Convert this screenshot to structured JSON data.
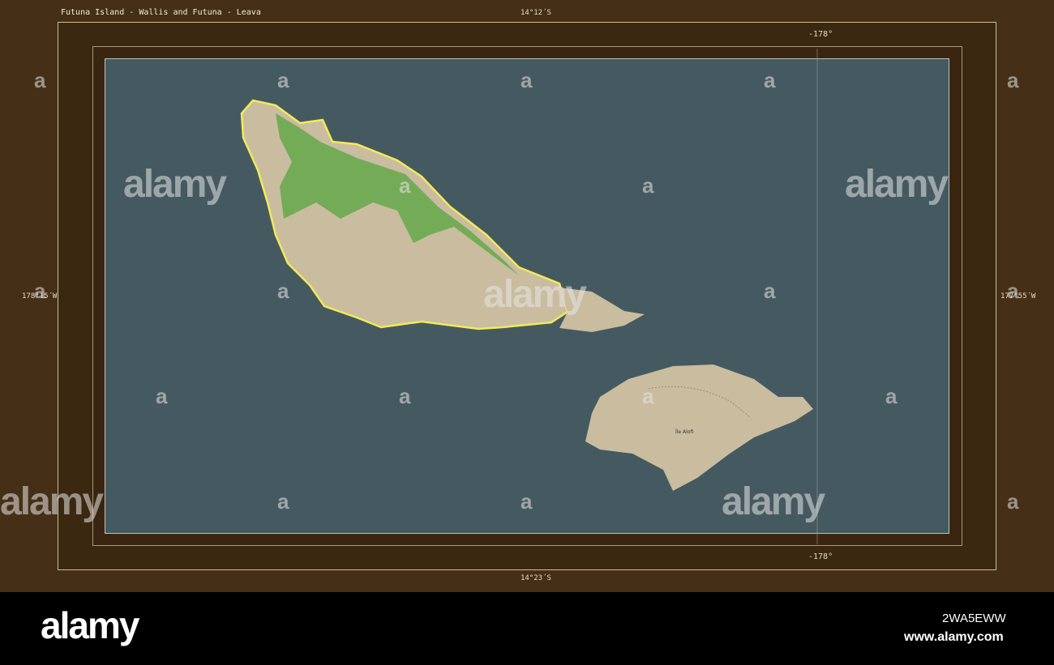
{
  "map": {
    "title": "Futuna Island - Wallis and Futuna - Leava",
    "lat_top": "14°12´S",
    "lat_bottom": "14°23´S",
    "lon_left": "178°15´W",
    "lon_right": "177°55´W",
    "meridian_top": "-178°",
    "meridian_bottom": "-178°",
    "place_label": "Île Alofi",
    "colors": {
      "sea": "#455a60",
      "land": "#c9bc9f",
      "forest": "#6aa84f",
      "highlight": "#f2ea5a",
      "frame": "#452f17"
    }
  },
  "watermark": {
    "brand": "alamy",
    "letter": "a"
  },
  "footer": {
    "logo": "alamy",
    "image_id": "2WA5EWW",
    "url": "www.alamy.com"
  }
}
